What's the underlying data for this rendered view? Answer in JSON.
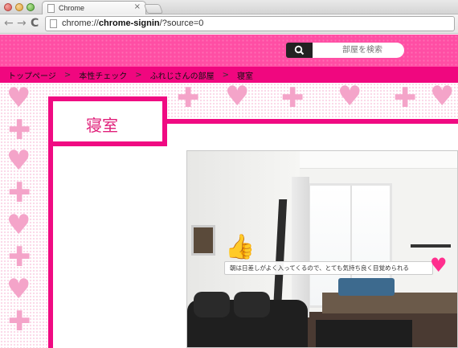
{
  "browser": {
    "tab_title": "Chrome",
    "tab_close": "×",
    "url_prefix": "chrome://",
    "url_bold": "chrome-signin",
    "url_suffix": "/?source=0",
    "back_icon": "←",
    "forward_icon": "→",
    "reload_icon": "C"
  },
  "header": {
    "search_placeholder": "部屋を検索"
  },
  "breadcrumb": {
    "items": [
      "トップページ",
      "本性チェック",
      "ふれじさんの部屋",
      "寝室"
    ],
    "separator": ">"
  },
  "page": {
    "title": "寝室"
  },
  "room": {
    "caption": "朝は日差しがよく入ってくるので、とても気持ち良く目覚められる"
  },
  "colors": {
    "brand_pink": "#f00a82",
    "header_pink": "#ff4ea4"
  }
}
